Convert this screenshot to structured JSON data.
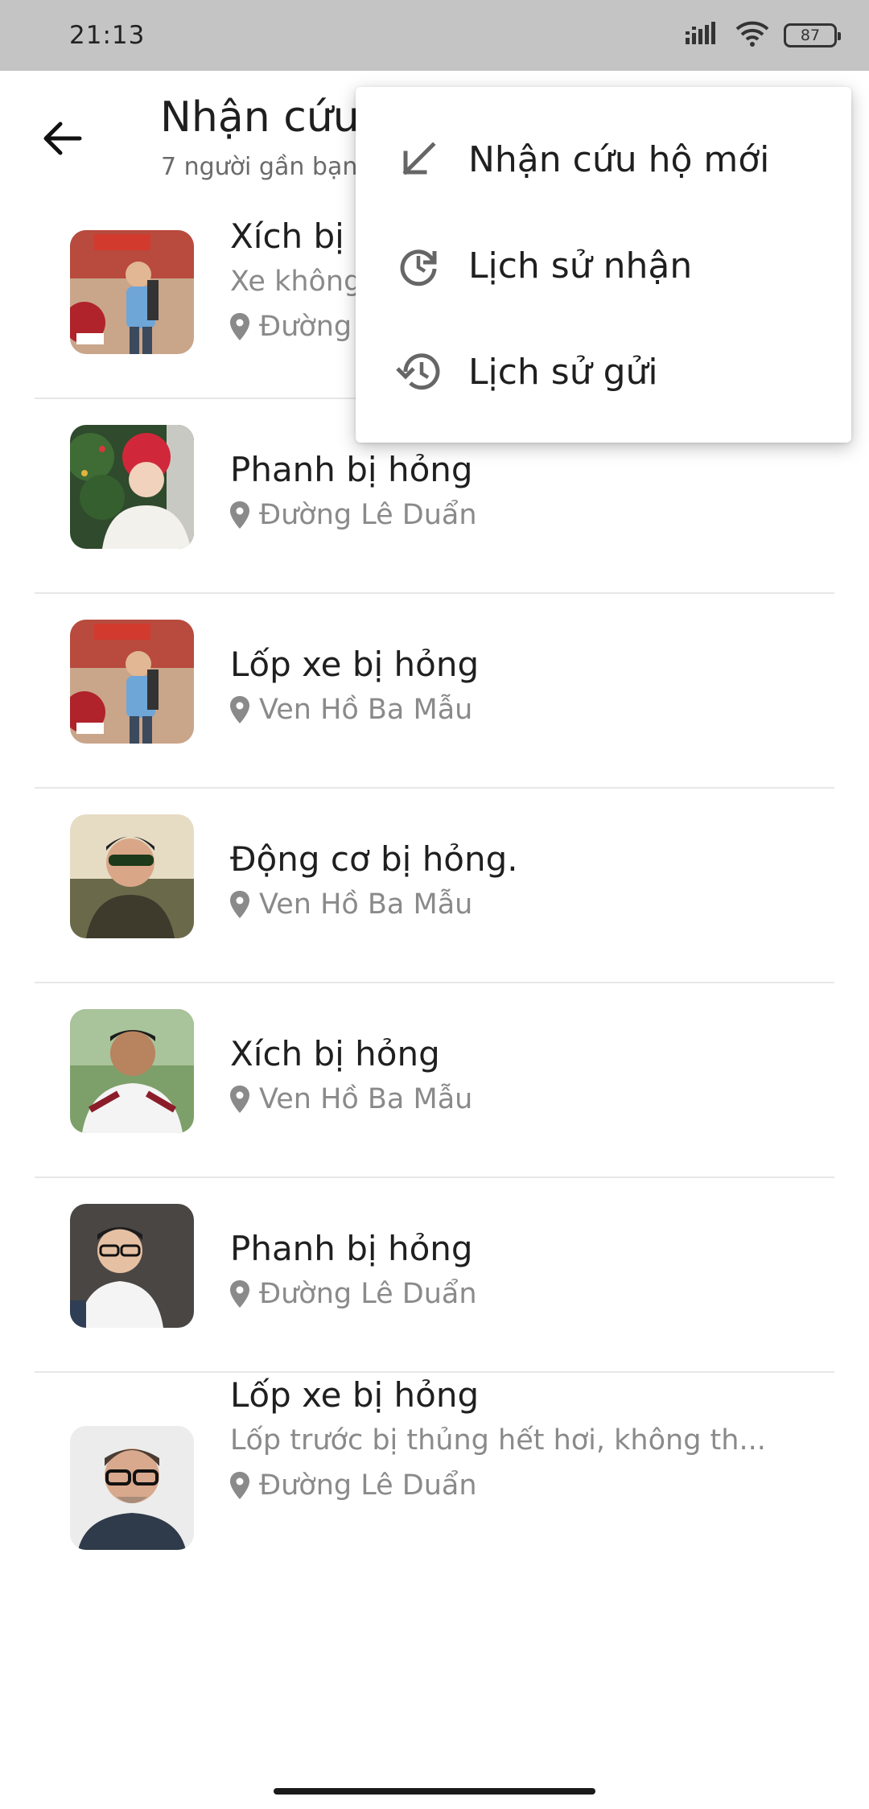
{
  "status_bar": {
    "time": "21:13",
    "battery": "87"
  },
  "header": {
    "title": "Nhận cứu hộ",
    "subtitle": "7 người gần bạn"
  },
  "requests": [
    {
      "title": "Xích bị hỏng",
      "description": "Xe không",
      "location": "Đường Lê Duẩn",
      "avatar": "avatar-1"
    },
    {
      "title": "Phanh bị hỏng",
      "description": "",
      "location": "Đường Lê Duẩn",
      "avatar": "avatar-2"
    },
    {
      "title": "Lốp xe bị hỏng",
      "description": "",
      "location": "Ven Hồ Ba Mẫu",
      "avatar": "avatar-1"
    },
    {
      "title": "Động cơ bị hỏng.",
      "description": "",
      "location": "Ven Hồ Ba Mẫu",
      "avatar": "avatar-3"
    },
    {
      "title": "Xích bị hỏng",
      "description": "",
      "location": "Ven Hồ Ba Mẫu",
      "avatar": "avatar-4"
    },
    {
      "title": "Phanh bị hỏng",
      "description": "",
      "location": "Đường Lê Duẩn",
      "avatar": "avatar-5"
    },
    {
      "title": "Lốp xe bị hỏng",
      "description": "Lốp trước bị thủng hết hơi, không th...",
      "location": "Đường Lê Duẩn",
      "avatar": "avatar-6"
    }
  ],
  "menu": {
    "items": [
      {
        "label": "Nhận cứu hộ mới",
        "icon": "arrow-down-left-icon"
      },
      {
        "label": "Lịch sử nhận",
        "icon": "clock-refresh-icon"
      },
      {
        "label": "Lịch sử gửi",
        "icon": "history-icon"
      }
    ]
  },
  "colors": {
    "status_bar": "#c4c4c4",
    "text_primary": "#1f1f1f",
    "text_secondary": "#8a8a8a",
    "divider": "#e7e7e7"
  }
}
